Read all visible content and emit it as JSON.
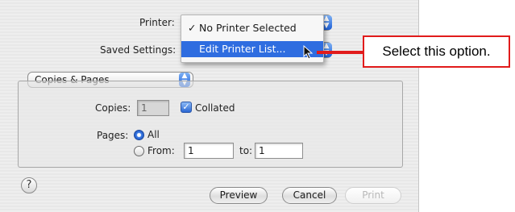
{
  "dialog": {
    "printer_label": "Printer:",
    "saved_settings_label": "Saved Settings:",
    "printer_menu": {
      "items": [
        {
          "check": "✓",
          "label": "No Printer Selected",
          "selected": false
        },
        {
          "check": "",
          "label": "Edit Printer List...",
          "selected": true
        }
      ]
    },
    "pane_popup": {
      "value": "Copies & Pages",
      "icon": "stepper-icon"
    },
    "copies_label": "Copies:",
    "copies_value": "1",
    "collated_label": "Collated",
    "collated_checked": true,
    "pages_label": "Pages:",
    "all_label": "All",
    "from_label": "From:",
    "from_value": "1",
    "to_label": "to:",
    "to_value": "1",
    "help_glyph": "?",
    "buttons": {
      "preview": "Preview",
      "cancel": "Cancel",
      "print": "Print"
    }
  },
  "callout": {
    "text": "Select this option.",
    "color": "#e11b1b"
  },
  "colors": {
    "highlight": "#2f6de0",
    "accent": "#1d5fd6"
  }
}
